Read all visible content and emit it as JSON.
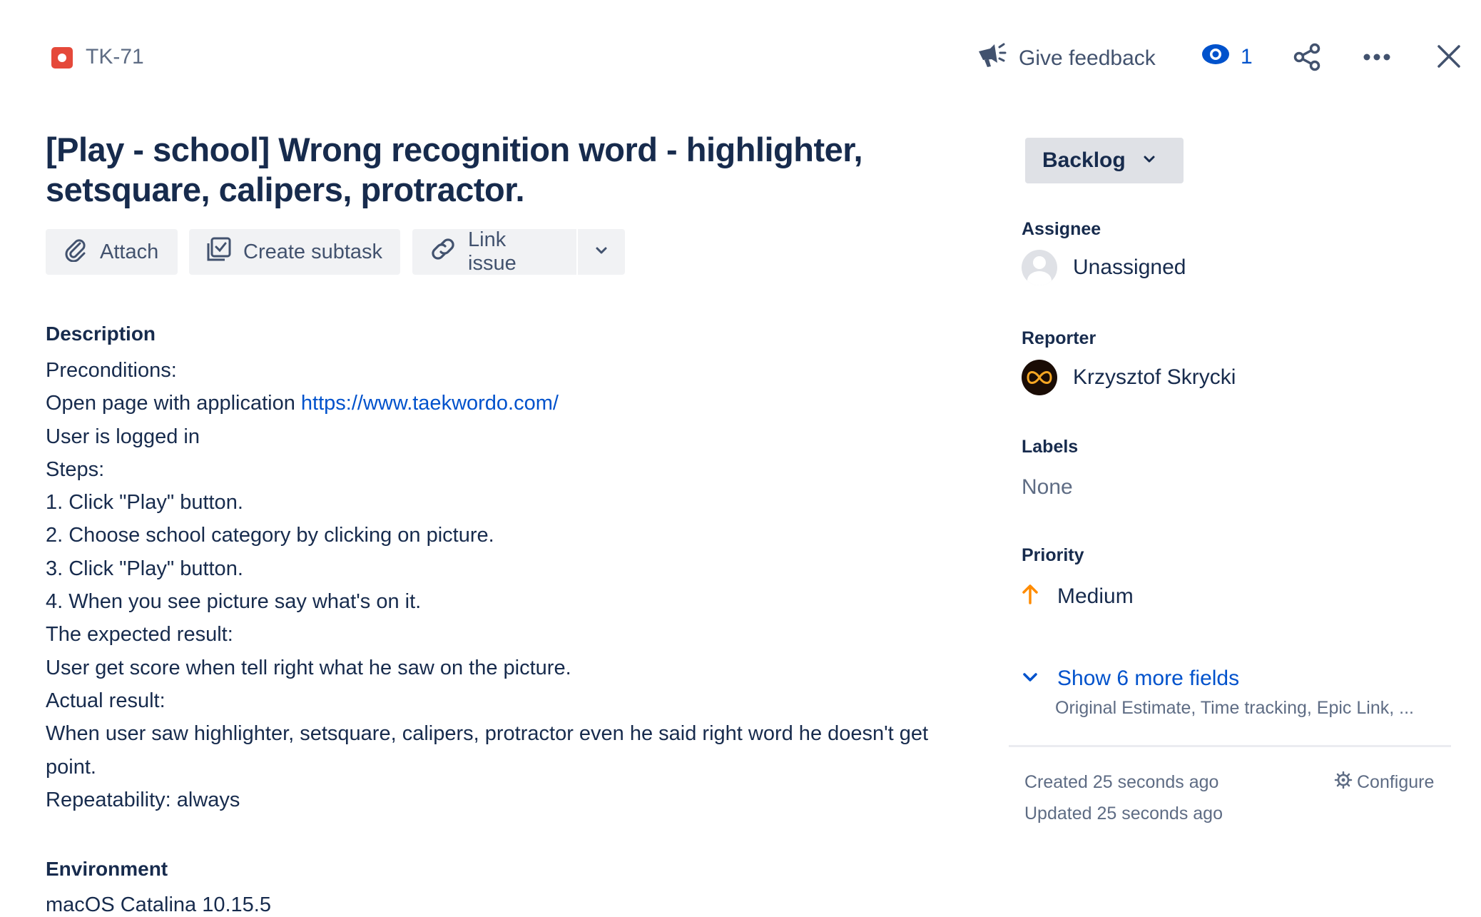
{
  "header": {
    "issue_key": "TK-71",
    "feedback_label": "Give feedback",
    "watch_count": "1"
  },
  "issue": {
    "title": "[Play - school] Wrong recognition word - highlighter, setsquare, calipers, protractor."
  },
  "actions": {
    "attach": "Attach",
    "create_subtask": "Create subtask",
    "link_issue": "Link issue"
  },
  "description": {
    "label": "Description",
    "lines": [
      "Preconditions:",
      "Open page with application ",
      "User is logged in",
      "Steps:",
      "1. Click \"Play\" button.",
      "2. Choose school category by clicking on picture.",
      "3. Click \"Play\" button.",
      "4. When you see picture say what's on it.",
      "The expected result:",
      "User get score when tell right what he saw on the picture.",
      "Actual result:",
      "When user saw highlighter, setsquare, calipers, protractor even he said right word he doesn't get point.",
      "Repeatability: always"
    ],
    "link": "https://www.taekwordo.com/"
  },
  "environment": {
    "label": "Environment",
    "value": "macOS Catalina 10.15.5"
  },
  "sidebar": {
    "status": "Backlog",
    "assignee_label": "Assignee",
    "assignee_value": "Unassigned",
    "reporter_label": "Reporter",
    "reporter_value": "Krzysztof Skrycki",
    "labels_label": "Labels",
    "labels_value": "None",
    "priority_label": "Priority",
    "priority_value": "Medium",
    "more_fields_label": "Show 6 more fields",
    "more_fields_sub": "Original Estimate, Time tracking, Epic Link, ...",
    "created": "Created 25 seconds ago",
    "updated": "Updated 25 seconds ago",
    "configure": "Configure"
  },
  "colors": {
    "bug": "#e5493a",
    "link": "#0052cc",
    "priority_medium": "#ff8b00",
    "text": "#172b4d",
    "subtle": "#5e6c84"
  }
}
